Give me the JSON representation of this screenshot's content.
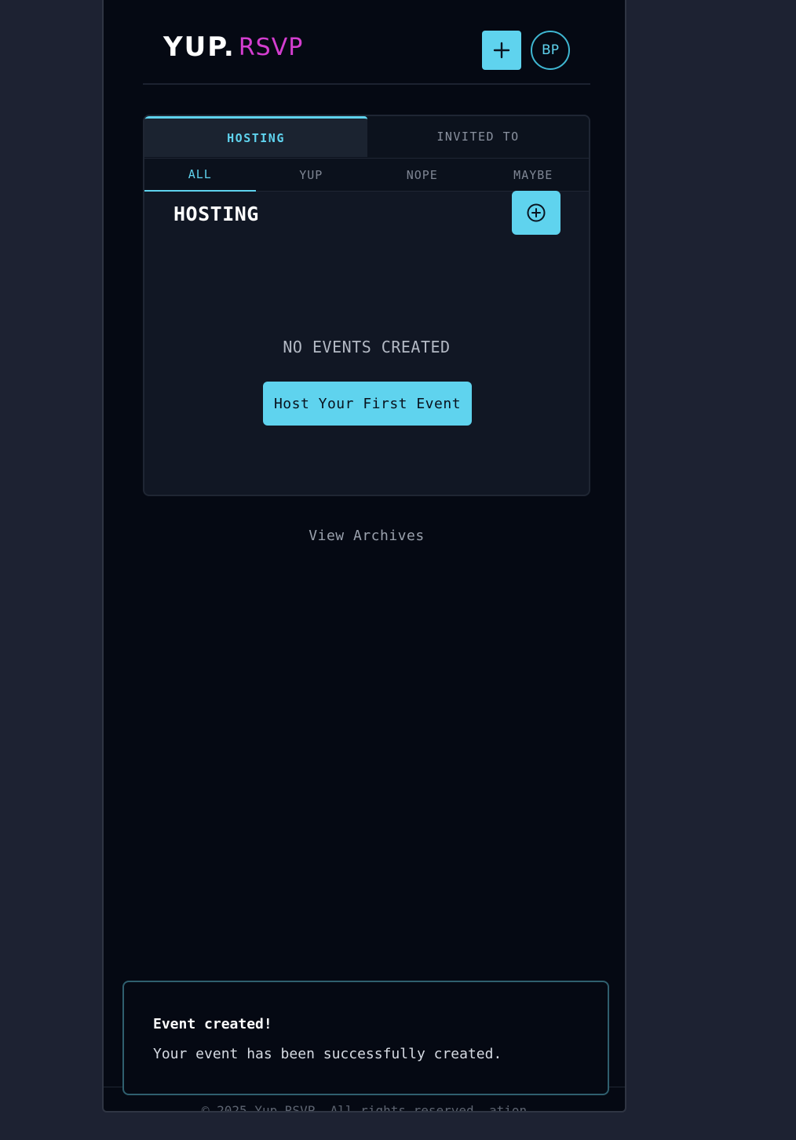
{
  "header": {
    "logo_mark": "YUP.",
    "logo_rsvp": "RSVP",
    "avatar_initials": "BP",
    "add_icon": "plus-icon"
  },
  "tabs": {
    "main": [
      {
        "label": "HOSTING",
        "active": true
      },
      {
        "label": "INVITED TO",
        "active": false
      }
    ],
    "filters": [
      {
        "label": "ALL",
        "active": true
      },
      {
        "label": "YUP",
        "active": false
      },
      {
        "label": "NOPE",
        "active": false
      },
      {
        "label": "MAYBE",
        "active": false
      }
    ]
  },
  "section": {
    "title": "HOSTING",
    "add_icon": "plus-circle-icon",
    "empty_text": "NO EVENTS CREATED",
    "cta_label": "Host Your First Event"
  },
  "archives_label": "View Archives",
  "footer_text": "© 2025 Yup.RSVP. All rights reserved. ation",
  "toast": {
    "title": "Event created!",
    "message": "Your event has been successfully created."
  },
  "colors": {
    "accent": "#5fd3ee",
    "brand_pink": "#d43ed0",
    "background": "#050913",
    "card": "#111724"
  }
}
